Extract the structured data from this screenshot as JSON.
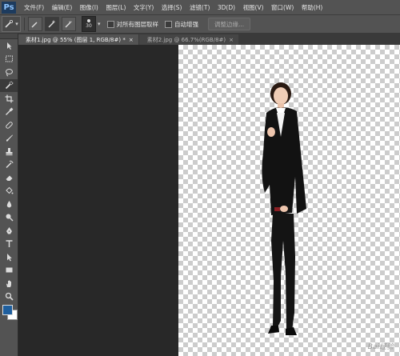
{
  "app": {
    "logo_text": "Ps"
  },
  "menu": [
    "文件(F)",
    "编辑(E)",
    "图像(I)",
    "图层(L)",
    "文字(Y)",
    "选择(S)",
    "滤镜(T)",
    "3D(D)",
    "视图(V)",
    "窗口(W)",
    "帮助(H)"
  ],
  "options": {
    "brush_size": "30",
    "sample_all_layers": "对所有图层取样",
    "auto_enhance": "自动增强",
    "refine_edge": "调整边缘..."
  },
  "tabs": [
    {
      "label": "素材1.jpg @ 55% (图层 1, RGB/8#) *",
      "close": "×"
    },
    {
      "label": "素材2.jpg @ 66.7%(RGB/8#)",
      "close": "×"
    }
  ],
  "tools": [
    "move",
    "marquee",
    "lasso",
    "quick-selection",
    "crop",
    "eyedropper",
    "healing",
    "brush",
    "clone-stamp",
    "history-brush",
    "eraser",
    "gradient",
    "dodge",
    "pen",
    "type",
    "path-selection",
    "rectangle",
    "hand",
    "zoom"
  ],
  "colors": {
    "foreground": "#1f5f9e",
    "background": "#ffffff"
  },
  "watermark": "Bai经验"
}
